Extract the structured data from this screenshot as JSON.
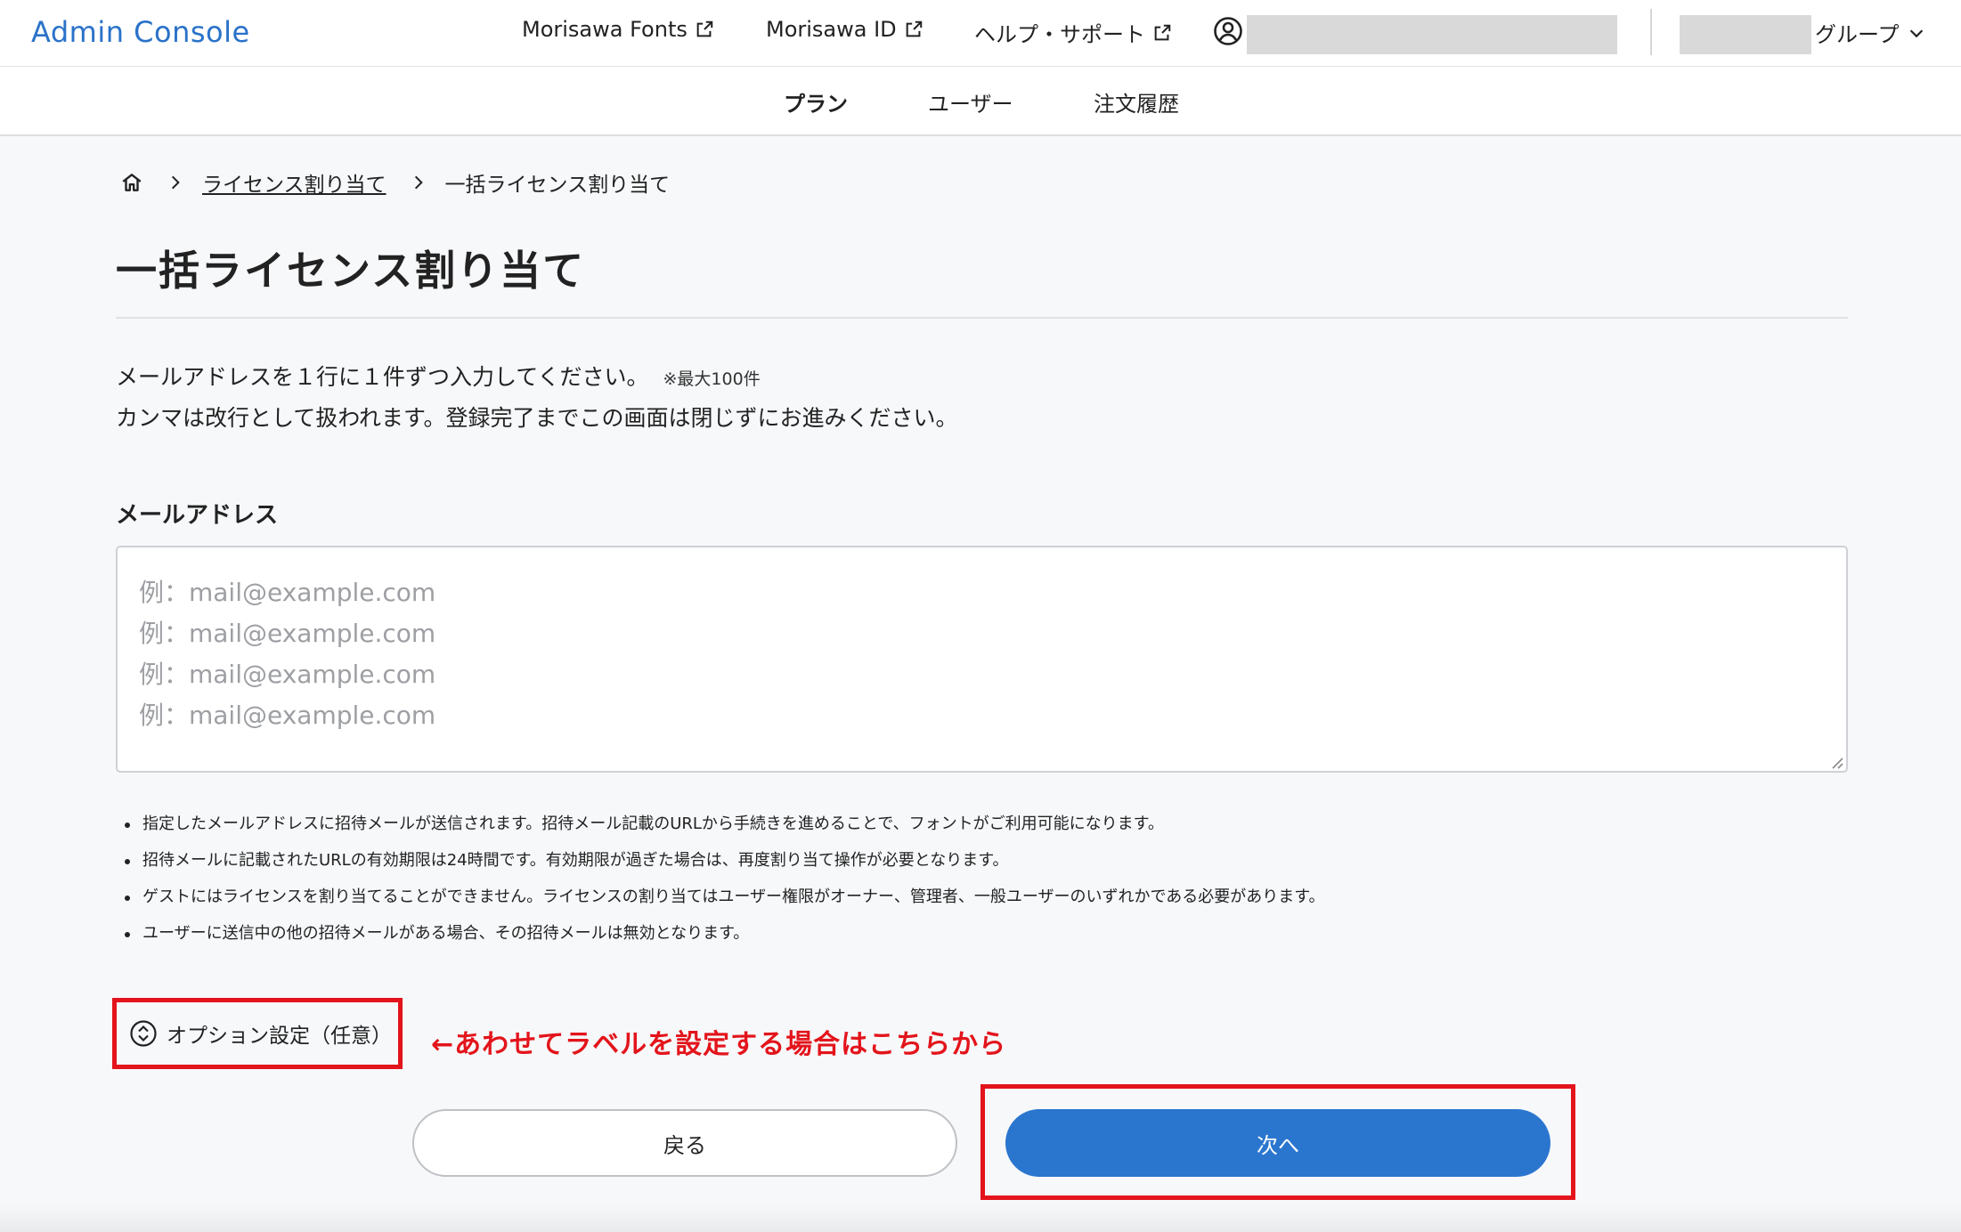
{
  "header": {
    "logo": "Admin Console",
    "links": [
      {
        "label": "Morisawa Fonts",
        "icon": "external-link-icon"
      },
      {
        "label": "Morisawa ID",
        "icon": "external-link-icon"
      },
      {
        "label": "ヘルプ・サポート",
        "icon": "external-link-icon"
      }
    ],
    "user_icon": "user-circle-icon",
    "group_label": "グループ",
    "group_icon": "chevron-down-icon"
  },
  "subnav": {
    "items": [
      {
        "label": "プラン",
        "active": true
      },
      {
        "label": "ユーザー",
        "active": false
      },
      {
        "label": "注文履歴",
        "active": false
      }
    ]
  },
  "breadcrumb": {
    "home_icon": "home-icon",
    "items": [
      "ライセンス割り当て",
      "一括ライセンス割り当て"
    ]
  },
  "page": {
    "title": "一括ライセンス割り当て",
    "desc_line1": "メールアドレスを１行に１件ずつ入力してください。",
    "desc_note": "※最大100件",
    "desc_line2": "カンマは改行として扱われます。登録完了までこの画面は閉じずにお進みください。"
  },
  "email_field": {
    "label": "メールアドレス",
    "placeholder": "例：mail@example.com\n例：mail@example.com\n例：mail@example.com\n例：mail@example.com",
    "value": ""
  },
  "notes": [
    "指定したメールアドレスに招待メールが送信されます。招待メール記載のURLから手続きを進めることで、フォントがご利用可能になります。",
    "招待メールに記載されたURLの有効期限は24時間です。有効期限が過ぎた場合は、再度割り当て操作が必要となります。",
    "ゲストにはライセンスを割り当てることができません。ライセンスの割り当てはユーザー権限がオーナー、管理者、一般ユーザーのいずれかである必要があります。",
    "ユーザーに送信中の他の招待メールがある場合、その招待メールは無効となります。"
  ],
  "option": {
    "label": "オプション設定（任意）",
    "icon": "expand-collapse-icon"
  },
  "annotation": "←あわせてラベルを設定する場合はこちらから",
  "buttons": {
    "back": "戻る",
    "next": "次へ"
  },
  "colors": {
    "accent": "#2a76cf",
    "logo": "#2a72c9",
    "highlight": "#e3141b"
  }
}
